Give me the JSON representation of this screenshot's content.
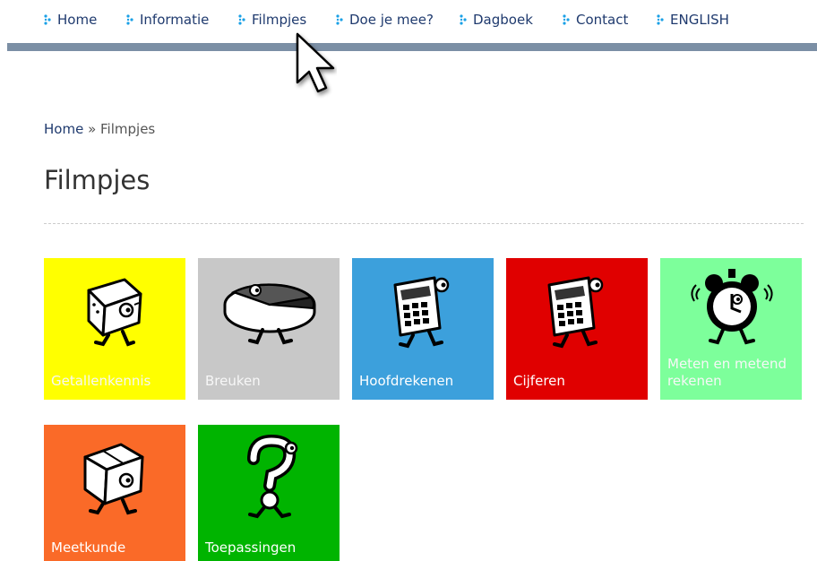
{
  "nav": {
    "items": [
      {
        "label": "Home"
      },
      {
        "label": "Informatie"
      },
      {
        "label": "Filmpjes"
      },
      {
        "label": "Doe je mee?"
      },
      {
        "label": "Dagboek"
      },
      {
        "label": "Contact"
      },
      {
        "label": "ENGLISH"
      }
    ]
  },
  "breadcrumb": {
    "home": "Home",
    "separator": " » ",
    "current": "Filmpjes"
  },
  "page": {
    "title": "Filmpjes"
  },
  "tiles": [
    {
      "label": "Getallenkennis",
      "color": "#ffff00",
      "icon": "cube-character-icon"
    },
    {
      "label": "Breuken",
      "color": "#c8c8c8",
      "icon": "pie-character-icon"
    },
    {
      "label": "Hoofdrekenen",
      "color": "#3ca0dc",
      "icon": "calculator-character-icon"
    },
    {
      "label": "Cijferen",
      "color": "#e00000",
      "icon": "calculator-character-icon"
    },
    {
      "label": "Meten en metend rekenen",
      "color": "#7dff9b",
      "icon": "alarm-clock-character-icon"
    },
    {
      "label": "Meetkunde",
      "color": "#fa6a28",
      "icon": "box-character-icon"
    },
    {
      "label": "Toepassingen",
      "color": "#00b400",
      "icon": "question-mark-character-icon"
    }
  ],
  "colors": {
    "nav_text": "#1f3a6e",
    "nav_arrow": "#1aa0e6",
    "nav_bar": "#7b8fa5"
  }
}
